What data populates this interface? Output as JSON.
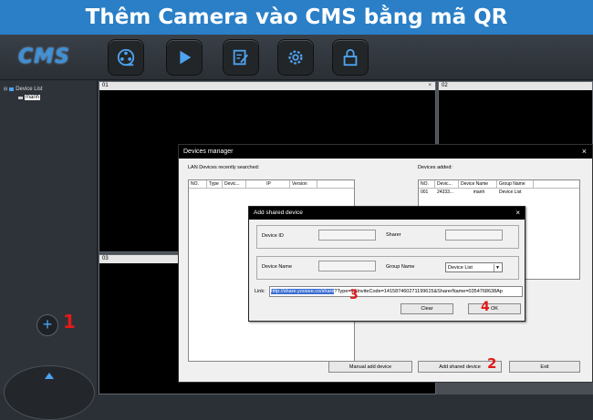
{
  "banner": {
    "title": "Thêm Camera vào CMS bằng mã QR"
  },
  "toolbar": {
    "logo": "CMS"
  },
  "sidebar": {
    "tree_root": "Device List",
    "tree_child": "manh",
    "add_button": "+"
  },
  "grid": {
    "cells": [
      {
        "label": "01"
      },
      {
        "label": "02"
      },
      {
        "label": "03"
      }
    ],
    "close": "×"
  },
  "devices_manager": {
    "title": "Devices manager",
    "close": "×",
    "lan_label": "LAN Devices recently searched:",
    "lan_columns": [
      "NO.",
      "Type",
      "Devic...",
      "IP",
      "Version"
    ],
    "added_label": "Devices added:",
    "added_columns": [
      "NO.",
      "Devic...",
      "Device Name",
      "Group Name"
    ],
    "added_rows": [
      {
        "no": "001",
        "device": "24333...",
        "name": "manh",
        "group": "Device List"
      }
    ],
    "manual_add": "Manual add device",
    "add_shared": "Add shared device",
    "exit": "Exit"
  },
  "add_shared_dialog": {
    "title": "Add shared device",
    "close": "×",
    "device_id_label": "Device ID",
    "sharer_label": "Sharer",
    "device_name_label": "Device Name",
    "group_name_label": "Group Name",
    "group_value": "Device List",
    "link_label": "Link:",
    "link_selected": "http://share.yoosee.co/share",
    "link_rest": "?Type=1&InviteCode=141587460271199615&SharerName=0354768638Ap",
    "clear": "Clear",
    "ok": "OK"
  },
  "steps": {
    "s1": "1",
    "s2": "2",
    "s3": "3",
    "s4": "4"
  },
  "colors": {
    "banner": "#2a7fc7",
    "accent": "#4ea3f0",
    "step": "#e21a1a"
  }
}
